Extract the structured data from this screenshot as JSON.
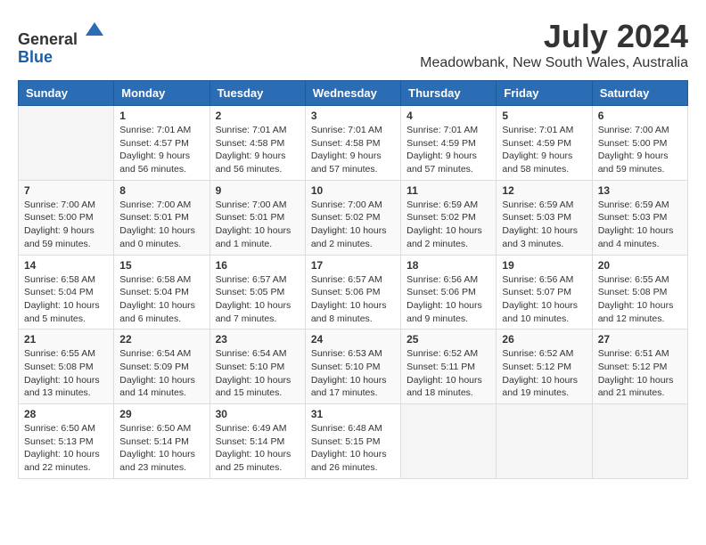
{
  "header": {
    "logo_line1": "General",
    "logo_line2": "Blue",
    "month_title": "July 2024",
    "location": "Meadowbank, New South Wales, Australia"
  },
  "calendar": {
    "headers": [
      "Sunday",
      "Monday",
      "Tuesday",
      "Wednesday",
      "Thursday",
      "Friday",
      "Saturday"
    ],
    "weeks": [
      [
        {
          "day": "",
          "sunrise": "",
          "sunset": "",
          "daylight": ""
        },
        {
          "day": "1",
          "sunrise": "Sunrise: 7:01 AM",
          "sunset": "Sunset: 4:57 PM",
          "daylight": "Daylight: 9 hours and 56 minutes."
        },
        {
          "day": "2",
          "sunrise": "Sunrise: 7:01 AM",
          "sunset": "Sunset: 4:58 PM",
          "daylight": "Daylight: 9 hours and 56 minutes."
        },
        {
          "day": "3",
          "sunrise": "Sunrise: 7:01 AM",
          "sunset": "Sunset: 4:58 PM",
          "daylight": "Daylight: 9 hours and 57 minutes."
        },
        {
          "day": "4",
          "sunrise": "Sunrise: 7:01 AM",
          "sunset": "Sunset: 4:59 PM",
          "daylight": "Daylight: 9 hours and 57 minutes."
        },
        {
          "day": "5",
          "sunrise": "Sunrise: 7:01 AM",
          "sunset": "Sunset: 4:59 PM",
          "daylight": "Daylight: 9 hours and 58 minutes."
        },
        {
          "day": "6",
          "sunrise": "Sunrise: 7:00 AM",
          "sunset": "Sunset: 5:00 PM",
          "daylight": "Daylight: 9 hours and 59 minutes."
        }
      ],
      [
        {
          "day": "7",
          "sunrise": "Sunrise: 7:00 AM",
          "sunset": "Sunset: 5:00 PM",
          "daylight": "Daylight: 9 hours and 59 minutes."
        },
        {
          "day": "8",
          "sunrise": "Sunrise: 7:00 AM",
          "sunset": "Sunset: 5:01 PM",
          "daylight": "Daylight: 10 hours and 0 minutes."
        },
        {
          "day": "9",
          "sunrise": "Sunrise: 7:00 AM",
          "sunset": "Sunset: 5:01 PM",
          "daylight": "Daylight: 10 hours and 1 minute."
        },
        {
          "day": "10",
          "sunrise": "Sunrise: 7:00 AM",
          "sunset": "Sunset: 5:02 PM",
          "daylight": "Daylight: 10 hours and 2 minutes."
        },
        {
          "day": "11",
          "sunrise": "Sunrise: 6:59 AM",
          "sunset": "Sunset: 5:02 PM",
          "daylight": "Daylight: 10 hours and 2 minutes."
        },
        {
          "day": "12",
          "sunrise": "Sunrise: 6:59 AM",
          "sunset": "Sunset: 5:03 PM",
          "daylight": "Daylight: 10 hours and 3 minutes."
        },
        {
          "day": "13",
          "sunrise": "Sunrise: 6:59 AM",
          "sunset": "Sunset: 5:03 PM",
          "daylight": "Daylight: 10 hours and 4 minutes."
        }
      ],
      [
        {
          "day": "14",
          "sunrise": "Sunrise: 6:58 AM",
          "sunset": "Sunset: 5:04 PM",
          "daylight": "Daylight: 10 hours and 5 minutes."
        },
        {
          "day": "15",
          "sunrise": "Sunrise: 6:58 AM",
          "sunset": "Sunset: 5:04 PM",
          "daylight": "Daylight: 10 hours and 6 minutes."
        },
        {
          "day": "16",
          "sunrise": "Sunrise: 6:57 AM",
          "sunset": "Sunset: 5:05 PM",
          "daylight": "Daylight: 10 hours and 7 minutes."
        },
        {
          "day": "17",
          "sunrise": "Sunrise: 6:57 AM",
          "sunset": "Sunset: 5:06 PM",
          "daylight": "Daylight: 10 hours and 8 minutes."
        },
        {
          "day": "18",
          "sunrise": "Sunrise: 6:56 AM",
          "sunset": "Sunset: 5:06 PM",
          "daylight": "Daylight: 10 hours and 9 minutes."
        },
        {
          "day": "19",
          "sunrise": "Sunrise: 6:56 AM",
          "sunset": "Sunset: 5:07 PM",
          "daylight": "Daylight: 10 hours and 10 minutes."
        },
        {
          "day": "20",
          "sunrise": "Sunrise: 6:55 AM",
          "sunset": "Sunset: 5:08 PM",
          "daylight": "Daylight: 10 hours and 12 minutes."
        }
      ],
      [
        {
          "day": "21",
          "sunrise": "Sunrise: 6:55 AM",
          "sunset": "Sunset: 5:08 PM",
          "daylight": "Daylight: 10 hours and 13 minutes."
        },
        {
          "day": "22",
          "sunrise": "Sunrise: 6:54 AM",
          "sunset": "Sunset: 5:09 PM",
          "daylight": "Daylight: 10 hours and 14 minutes."
        },
        {
          "day": "23",
          "sunrise": "Sunrise: 6:54 AM",
          "sunset": "Sunset: 5:10 PM",
          "daylight": "Daylight: 10 hours and 15 minutes."
        },
        {
          "day": "24",
          "sunrise": "Sunrise: 6:53 AM",
          "sunset": "Sunset: 5:10 PM",
          "daylight": "Daylight: 10 hours and 17 minutes."
        },
        {
          "day": "25",
          "sunrise": "Sunrise: 6:52 AM",
          "sunset": "Sunset: 5:11 PM",
          "daylight": "Daylight: 10 hours and 18 minutes."
        },
        {
          "day": "26",
          "sunrise": "Sunrise: 6:52 AM",
          "sunset": "Sunset: 5:12 PM",
          "daylight": "Daylight: 10 hours and 19 minutes."
        },
        {
          "day": "27",
          "sunrise": "Sunrise: 6:51 AM",
          "sunset": "Sunset: 5:12 PM",
          "daylight": "Daylight: 10 hours and 21 minutes."
        }
      ],
      [
        {
          "day": "28",
          "sunrise": "Sunrise: 6:50 AM",
          "sunset": "Sunset: 5:13 PM",
          "daylight": "Daylight: 10 hours and 22 minutes."
        },
        {
          "day": "29",
          "sunrise": "Sunrise: 6:50 AM",
          "sunset": "Sunset: 5:14 PM",
          "daylight": "Daylight: 10 hours and 23 minutes."
        },
        {
          "day": "30",
          "sunrise": "Sunrise: 6:49 AM",
          "sunset": "Sunset: 5:14 PM",
          "daylight": "Daylight: 10 hours and 25 minutes."
        },
        {
          "day": "31",
          "sunrise": "Sunrise: 6:48 AM",
          "sunset": "Sunset: 5:15 PM",
          "daylight": "Daylight: 10 hours and 26 minutes."
        },
        {
          "day": "",
          "sunrise": "",
          "sunset": "",
          "daylight": ""
        },
        {
          "day": "",
          "sunrise": "",
          "sunset": "",
          "daylight": ""
        },
        {
          "day": "",
          "sunrise": "",
          "sunset": "",
          "daylight": ""
        }
      ]
    ]
  }
}
